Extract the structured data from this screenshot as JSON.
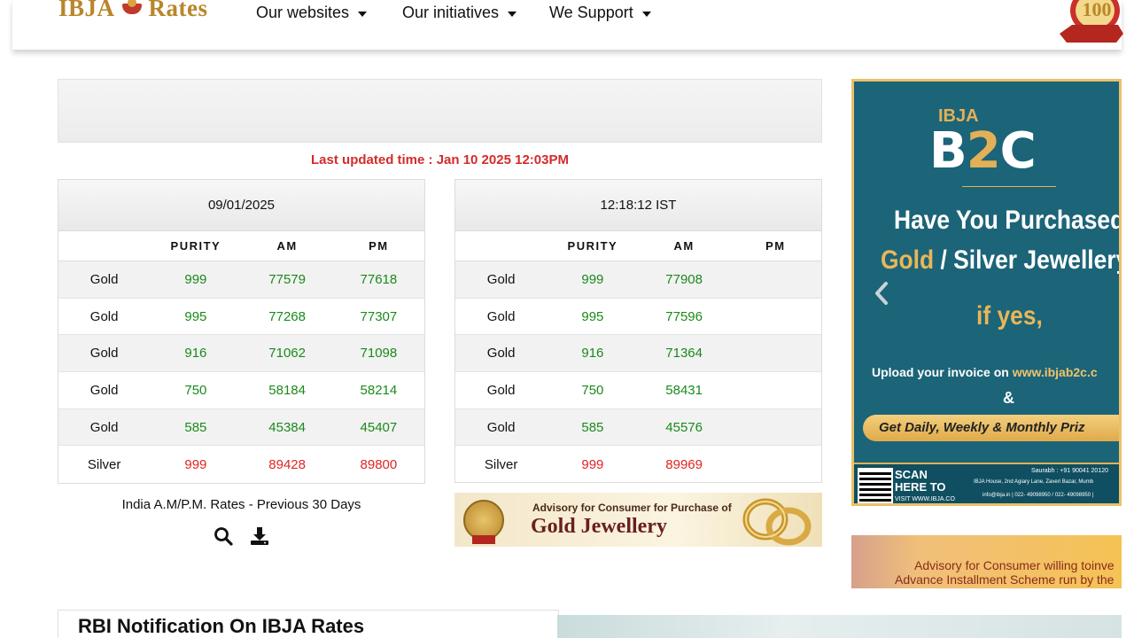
{
  "header": {
    "logo_text_left": "IBJA",
    "logo_text_right": "Rates",
    "nav": [
      {
        "label": "Our websites"
      },
      {
        "label": "Our initiatives"
      },
      {
        "label": "We Support"
      }
    ],
    "badge_text": "100"
  },
  "last_updated": "Last updated time : Jan 10 2025 12:03PM",
  "tables": [
    {
      "title": "09/01/2025",
      "columns": [
        "",
        "PURITY",
        "AM",
        "PM"
      ],
      "rows": [
        {
          "metal": "Gold",
          "purity": "999",
          "am": "77579",
          "pm": "77618"
        },
        {
          "metal": "Gold",
          "purity": "995",
          "am": "77268",
          "pm": "77307"
        },
        {
          "metal": "Gold",
          "purity": "916",
          "am": "71062",
          "pm": "71098"
        },
        {
          "metal": "Gold",
          "purity": "750",
          "am": "58184",
          "pm": "58214"
        },
        {
          "metal": "Gold",
          "purity": "585",
          "am": "45384",
          "pm": "45407"
        },
        {
          "metal": "Silver",
          "purity": "999",
          "am": "89428",
          "pm": "89800"
        }
      ]
    },
    {
      "title": "12:18:12 IST",
      "columns": [
        "",
        "PURITY",
        "AM",
        "PM"
      ],
      "rows": [
        {
          "metal": "Gold",
          "purity": "999",
          "am": "77908",
          "pm": ""
        },
        {
          "metal": "Gold",
          "purity": "995",
          "am": "77596",
          "pm": ""
        },
        {
          "metal": "Gold",
          "purity": "916",
          "am": "71364",
          "pm": ""
        },
        {
          "metal": "Gold",
          "purity": "750",
          "am": "58431",
          "pm": ""
        },
        {
          "metal": "Gold",
          "purity": "585",
          "am": "45576",
          "pm": ""
        },
        {
          "metal": "Silver",
          "purity": "999",
          "am": "89969",
          "pm": ""
        }
      ]
    }
  ],
  "previous_days_label": "India A.M/P.M. Rates - Previous 30 Days",
  "icons": {
    "search": "search-icon",
    "download": "download-icon",
    "carousel_prev": "chevron-left-icon"
  },
  "advisory_gold": {
    "small": "Advisory for Consumer for Purchase of",
    "large": "Gold Jewellery"
  },
  "promo": {
    "ibja": "IBJA",
    "b2c_left": "B",
    "b2c_mid": "2",
    "b2c_right": "C",
    "headline1": "Have You Purchased",
    "headline2_gold": "Gold",
    "headline2_rest": " / Silver Jewellery",
    "ifyes": "if yes,",
    "upload_prefix": "Upload your invoice on ",
    "upload_url": "www.ibjab2c.c",
    "amp": "&",
    "pill": "Get Daily, Weekly & Monthly Priz",
    "scan": "SCAN HERE TO",
    "visit": "VISIT WWW.IBJA.CO",
    "contact_name": "Saurabh : +91 90041 20120",
    "address": "IBJA House, 2nd Agiary Lane, Zaveri Bazar, Mumb",
    "contact_line": "info@ibja.in  |  022- 49098950 / 022- 49098950  |"
  },
  "advisory_invest": {
    "line1": "Advisory for Consumer willing toinve",
    "line2": "Advance Installment Scheme run by the"
  },
  "rbi_title": "RBI Notification On IBJA Rates",
  "colors": {
    "red": "#d32b2b",
    "green": "#1a8a1a",
    "promo_bg": "#1c6478",
    "gold": "#e3b057"
  }
}
